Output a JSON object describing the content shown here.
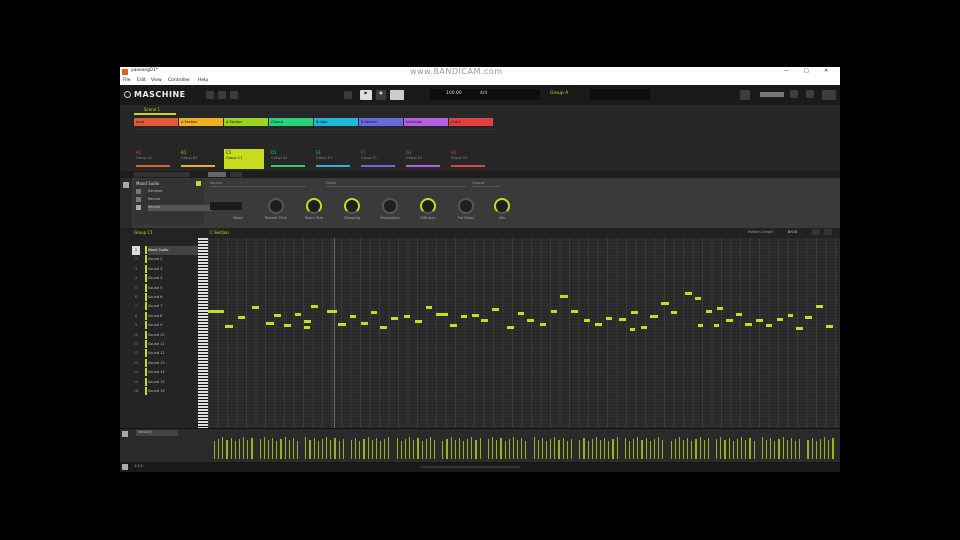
{
  "window": {
    "title": "yaosong01*",
    "controls": [
      "—",
      "□",
      "✕"
    ]
  },
  "watermark": "www.BANDICAM.com",
  "menu": [
    "File",
    "Edit",
    "View",
    "Controller",
    "Help"
  ],
  "toolbar": {
    "logo": "MASCHINE",
    "tempo": "100.00",
    "signature": "4/4",
    "groove": "Group A"
  },
  "arranger": {
    "section": "Scene 1",
    "scenes": [
      {
        "label": "Intro",
        "color": "#e05a3a"
      },
      {
        "label": "A Section",
        "color": "#f0b020"
      },
      {
        "label": "A Section",
        "color": "#9ad420"
      },
      {
        "label": "Chorus",
        "color": "#2ad07a"
      },
      {
        "label": "Bridge",
        "color": "#20b8d8"
      },
      {
        "label": "B Section",
        "color": "#6a6ae0"
      },
      {
        "label": "Interlude",
        "color": "#b060e0"
      },
      {
        "label": "Outro",
        "color": "#e04040"
      }
    ],
    "groups": [
      {
        "id": "A1",
        "label": "Group A1",
        "color": "#e05a3a"
      },
      {
        "id": "B1",
        "label": "Group B1",
        "color": "#f0b020"
      },
      {
        "id": "C1",
        "label": "Group C1",
        "color": "#c8dc1e"
      },
      {
        "id": "D1",
        "label": "Group D1",
        "color": "#2ad07a"
      },
      {
        "id": "E1",
        "label": "Group E1",
        "color": "#20b8d8"
      },
      {
        "id": "F1",
        "label": "Group F1",
        "color": "#6a6ae0"
      },
      {
        "id": "G1",
        "label": "Group G1",
        "color": "#b060e0"
      },
      {
        "id": "H1",
        "label": "Group H1",
        "color": "#e04040"
      }
    ]
  },
  "controls": {
    "plugin": "Mood Sudio",
    "plugin_slots": [
      "Sampler",
      "Reverb",
      "Reverb"
    ],
    "tabs": [
      "Main",
      "Edit"
    ],
    "sections": [
      "Source",
      "Delay",
      "Output"
    ],
    "knobs": [
      {
        "label": "Mood",
        "on": false
      },
      {
        "label": "Reverb Time",
        "on": false
      },
      {
        "label": "Room Size",
        "on": true
      },
      {
        "label": "Damping",
        "on": true
      },
      {
        "label": "Modulation",
        "on": false
      },
      {
        "label": "Diffusion",
        "on": true
      },
      {
        "label": "Pre Delay",
        "on": false
      },
      {
        "label": "Mix",
        "on": true
      }
    ]
  },
  "editor": {
    "group_label": "Group C1",
    "pattern_label": "C Section",
    "pattern_length": "Pattern Length",
    "pattern_value": "8:0:0",
    "sounds": [
      "Mood Sudio",
      "Sound 2",
      "Sound 3",
      "Sound 4",
      "Sound 5",
      "Sound 6",
      "Sound 7",
      "Sound 8",
      "Sound 9",
      "Sound 10",
      "Sound 11",
      "Sound 12",
      "Sound 13",
      "Sound 14",
      "Sound 15",
      "Sound 16"
    ],
    "lane_label": "Velocity",
    "status": "1:1:1"
  }
}
